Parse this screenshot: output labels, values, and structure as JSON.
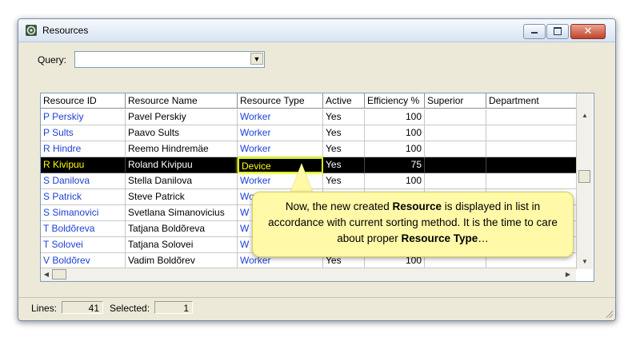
{
  "window": {
    "title": "Resources",
    "icon": "resources-app-icon"
  },
  "query": {
    "label": "Query:",
    "value": ""
  },
  "grid": {
    "headers": [
      "Resource ID",
      "Resource Name",
      "Resource Type",
      "Active",
      "Efficiency %",
      "Superior",
      "Department"
    ],
    "rows": [
      [
        "P Perskiy",
        "Pavel Perskiy",
        "Worker",
        "Yes",
        "100",
        "",
        ""
      ],
      [
        "P Sults",
        "Paavo Sults",
        "Worker",
        "Yes",
        "100",
        "",
        ""
      ],
      [
        "R Hindre",
        "Reemo Hindremäe",
        "Worker",
        "Yes",
        "100",
        "",
        ""
      ],
      [
        "R Kivipuu",
        "Roland Kivipuu",
        "Device",
        "Yes",
        "75",
        "",
        ""
      ],
      [
        "S Danilova",
        "Stella Danilova",
        "Worker",
        "Yes",
        "100",
        "",
        ""
      ],
      [
        "S Patrick",
        "Steve Patrick",
        "Wo",
        "",
        "",
        "",
        ""
      ],
      [
        "S Simanovici",
        "Svetlana Simanovicius",
        "W",
        "",
        "",
        "",
        ""
      ],
      [
        "T Boldõreva",
        "Tatjana Boldõreva",
        "W",
        "",
        "",
        "",
        ""
      ],
      [
        "T Solovei",
        "Tatjana Solovei",
        "W",
        "",
        "",
        "",
        ""
      ],
      [
        "V Boldõrev",
        "Vadim Boldõrev",
        "Worker",
        "Yes",
        "100",
        "",
        ""
      ]
    ],
    "selected_row": 3
  },
  "status": {
    "lines_label": "Lines:",
    "lines_value": "41",
    "selected_label": "Selected:",
    "selected_value": "1"
  },
  "callout": {
    "part1": "Now, the new created ",
    "bold1": "Resource",
    "part2": " is displayed in list in accordance with current sorting method. It is the time to care about proper ",
    "bold2": "Resource Type",
    "part3": "…"
  },
  "colors": {
    "link": "#1f3fd6",
    "selection": "#000000",
    "highlight": "#ffff00",
    "callout_bg": "#fff9a8"
  }
}
